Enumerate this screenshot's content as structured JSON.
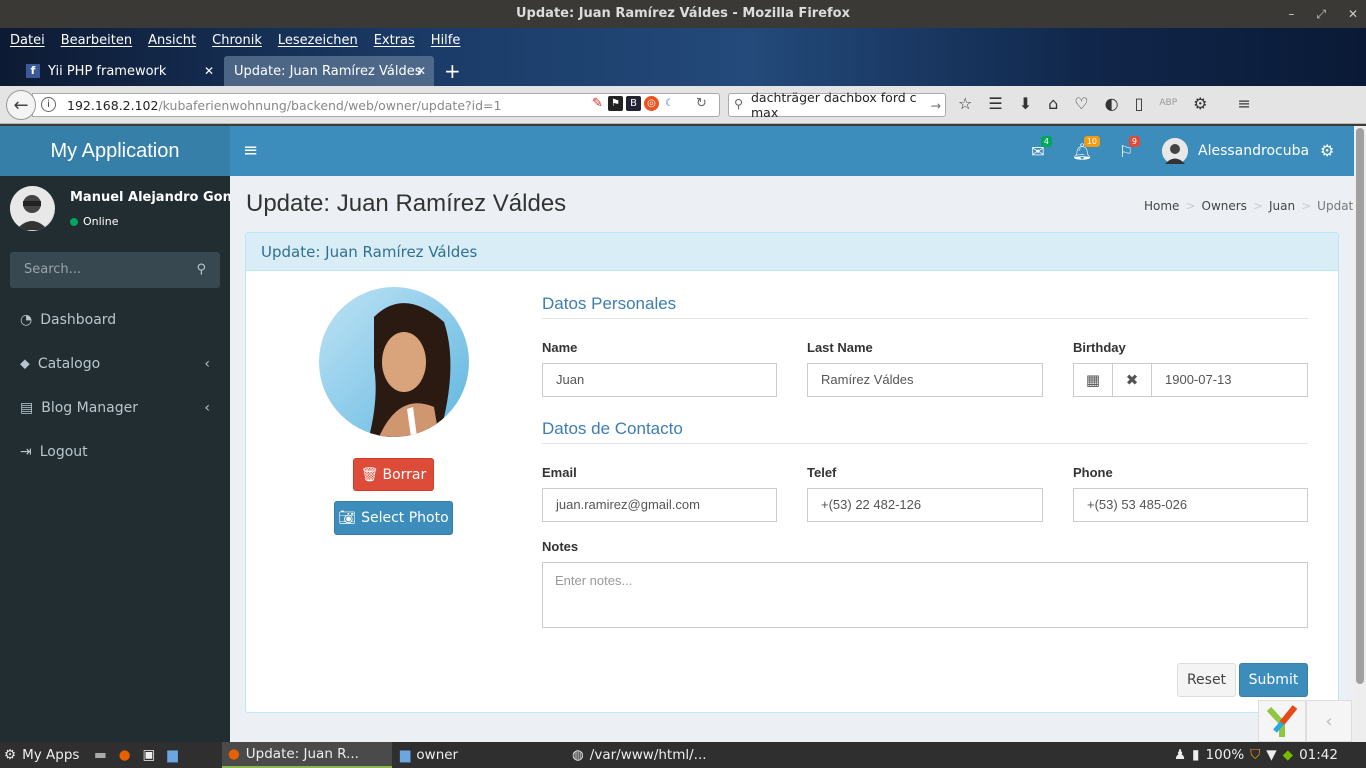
{
  "window": {
    "title": "Update: Juan Ramírez Váldes - Mozilla Firefox"
  },
  "menubar": [
    "Datei",
    "Bearbeiten",
    "Ansicht",
    "Chronik",
    "Lesezeichen",
    "Extras",
    "Hilfe"
  ],
  "tabs": [
    {
      "label": "Yii PHP framework"
    },
    {
      "label": "Update: Juan Ramírez Váldes"
    }
  ],
  "url": {
    "host": "192.168.2.102",
    "path": "/kubaferienwohnung/backend/web/owner/update?id=1"
  },
  "search_bar": {
    "value": "dachträger  dachbox ford c max"
  },
  "app": {
    "name": "My Application",
    "user": {
      "name": "Manuel Alejandro Gonzalez",
      "status": "Online"
    },
    "sidebar_search_placeholder": "Search...",
    "menu": [
      {
        "label": "Dashboard",
        "icon": "dashboard-icon"
      },
      {
        "label": "Catalogo",
        "icon": "tag-icon",
        "expandable": true
      },
      {
        "label": "Blog Manager",
        "icon": "book-icon",
        "expandable": true
      },
      {
        "label": "Logout",
        "icon": "sign-out-icon"
      }
    ],
    "topbar": {
      "messages_count": "4",
      "notifications_count": "10",
      "tasks_count": "9",
      "username": "Alessandrocuba"
    }
  },
  "page": {
    "title": "Update: Juan Ramírez Váldes",
    "breadcrumb": [
      "Home",
      "Owners",
      "Juan",
      "Update"
    ],
    "box_title": "Update: Juan Ramírez Váldes",
    "buttons": {
      "delete": "Borrar",
      "select_photo": "Select Photo",
      "reset": "Reset",
      "submit": "Submit"
    },
    "sections": {
      "personal": "Datos Personales",
      "contact": "Datos de Contacto"
    },
    "form": {
      "name": {
        "label": "Name",
        "value": "Juan"
      },
      "last_name": {
        "label": "Last Name",
        "value": "Ramírez Váldes"
      },
      "birthday": {
        "label": "Birthday",
        "value": "1900-07-13"
      },
      "email": {
        "label": "Email",
        "value": "juan.ramirez@gmail.com"
      },
      "telef": {
        "label": "Telef",
        "value": "+(53) 22 482-126"
      },
      "phone": {
        "label": "Phone",
        "value": "+(53) 53 485-026"
      },
      "notes": {
        "label": "Notes",
        "placeholder": "Enter notes..."
      }
    }
  },
  "taskbar": {
    "start": "My Apps",
    "items": [
      "Update: Juan R...",
      "owner",
      "/var/www/html/..."
    ],
    "battery": "100%",
    "time": "01:42"
  },
  "colors": {
    "sidebar": "#222d32",
    "header": "#3c8dbc",
    "logo": "#367fa9",
    "danger": "#dd4b39",
    "box_header": "#d9edf7"
  }
}
